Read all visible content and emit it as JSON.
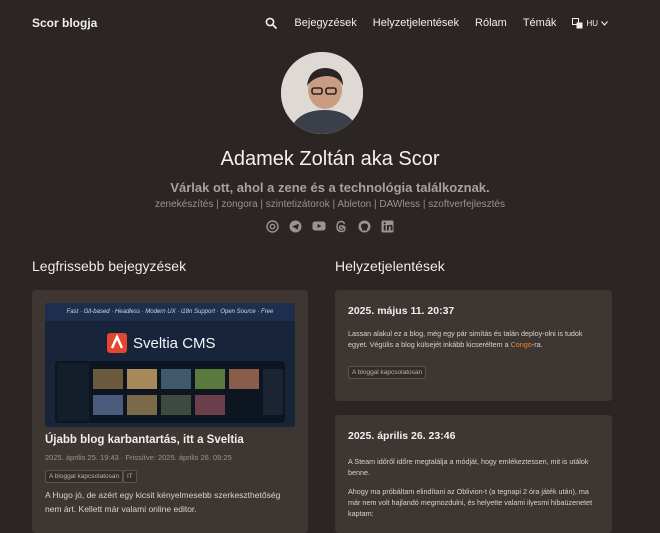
{
  "header": {
    "brand": "Scor blogja",
    "nav": [
      "Bejegyzések",
      "Helyzetjelentések",
      "Rólam",
      "Témák"
    ],
    "lang": "HU"
  },
  "profile": {
    "name": "Adamek Zoltán aka Scor",
    "tagline": "Várlak ott, ahol a zene és a technológia találkoznak.",
    "keywords": "zenekészítés | zongora | szintetizátorok | Ableton | DAWless | szoftverfejlesztés",
    "socials": [
      "at-icon",
      "telegram-icon",
      "youtube-icon",
      "threads-icon",
      "github-icon",
      "linkedin-icon"
    ]
  },
  "latest": {
    "heading": "Legfrissebb bejegyzések",
    "post": {
      "banner_tagline": "Fast · Git-based · Headless · Modern UX · i18n Support · Open Source · Free",
      "banner_title": "Sveltia CMS",
      "title": "Újabb blog karbantartás, itt a Sveltia",
      "meta": "2025. április 25. 19:43 · Frissítve: 2025. április 26. 09:25",
      "tags": [
        "A bloggal kapcsolatosan",
        "IT"
      ],
      "excerpt": "A Hugo jó, de azért egy kicsit kényelmesebb szerkeszthetőség nem árt. Kellett már valami online editor."
    }
  },
  "status": {
    "heading": "Helyzetjelentések",
    "items": [
      {
        "date": "2025. május 11. 20:37",
        "text_before": "Lassan alakul ez a blog, még egy pár simítás és talán deploy-olni is tudok egyet. Végülis a blog külsejét inkább kicseréltem a ",
        "link": "Congo",
        "text_after": "-ra.",
        "tag": "A bloggal kapcsolatosan"
      },
      {
        "date": "2025. április 26. 23:46",
        "p1": "A Steam időről időre megtalálja a módját, hogy emlékeztessen, mit is utálok benne.",
        "p2": "Ahogy ma próbáltam elindítani az Oblivion-t (a tegnapi 2 óra játék után), ma már nem volt hajlandó megmozdulni, és helyette valami ilyesmi hibaüzenetet kaptam:"
      }
    ]
  },
  "colors": {
    "background": "#2b2523",
    "card": "#3d3633",
    "accent_link": "#f08a24",
    "banner_red": "#e4472f"
  }
}
